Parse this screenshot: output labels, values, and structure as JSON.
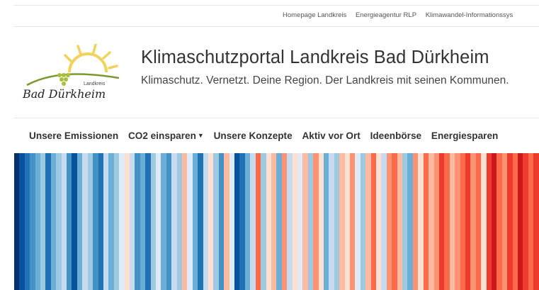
{
  "top_links": [
    "Homepage Landkreis",
    "Energieagentur RLP",
    "Klimawandel-Informationssys"
  ],
  "logo": {
    "small_text": "Landkreis",
    "script_text": "Bad Dürkheim",
    "sun_color": "#f2d35a",
    "hills_color": "#7a9a2e",
    "grapes_color": "#a8be3c"
  },
  "header": {
    "title": "Klimaschutzportal Landkreis Bad Dürkheim",
    "tagline": "Klimaschutz. Vernetzt. Deine Region. Der Landkreis mit seinen Kommunen."
  },
  "nav": [
    {
      "label": "Unsere Emissionen",
      "dropdown": false
    },
    {
      "label": "CO2 einsparen",
      "dropdown": true
    },
    {
      "label": "Unsere Konzepte",
      "dropdown": false
    },
    {
      "label": "Aktiv vor Ort",
      "dropdown": false
    },
    {
      "label": "Ideenbörse",
      "dropdown": false
    },
    {
      "label": "Energiesparen",
      "dropdown": false
    }
  ],
  "warming_stripes": [
    "#08306b",
    "#08519c",
    "#2171b5",
    "#4292c6",
    "#6baed6",
    "#9ecae1",
    "#2171b5",
    "#6baed6",
    "#9ecae1",
    "#c6dbef",
    "#4292c6",
    "#08519c",
    "#6baed6",
    "#c6dbef",
    "#9ecae1",
    "#4292c6",
    "#2171b5",
    "#c6dbef",
    "#6baed6",
    "#9ecae1",
    "#deebf7",
    "#fee0d2",
    "#c6dbef",
    "#4292c6",
    "#6baed6",
    "#2171b5",
    "#9ecae1",
    "#deebf7",
    "#6baed6",
    "#4292c6",
    "#c6dbef",
    "#9ecae1",
    "#fcbba1",
    "#deebf7",
    "#6baed6",
    "#2171b5",
    "#c6dbef",
    "#fee0d2",
    "#9ecae1",
    "#4292c6",
    "#fcbba1",
    "#deebf7",
    "#08519c",
    "#2171b5",
    "#6baed6",
    "#c6dbef",
    "#fb6a4a",
    "#9ecae1",
    "#fee0d2",
    "#fcbba1",
    "#6baed6",
    "#fc9272",
    "#c6dbef",
    "#fee0d2",
    "#deebf7",
    "#fcbba1",
    "#9ecae1",
    "#fc9272",
    "#fee0d2",
    "#6baed6",
    "#c6dbef",
    "#9ecae1",
    "#fcbba1",
    "#fee0d2",
    "#fc9272",
    "#deebf7",
    "#9ecae1",
    "#fcbba1",
    "#fb6a4a",
    "#fee0d2",
    "#c6dbef",
    "#fc9272",
    "#fb6a4a",
    "#fcbba1",
    "#9ecae1",
    "#6baed6",
    "#fc9272",
    "#fee0d2",
    "#fb6a4a",
    "#fcbba1",
    "#fc9272",
    "#ef3b2c",
    "#fb6a4a",
    "#fcbba1",
    "#fc9272",
    "#fb6a4a",
    "#ef3b2c",
    "#fc9272",
    "#fb6a4a",
    "#fee0d2",
    "#ef3b2c",
    "#cb181d",
    "#fb6a4a",
    "#fc9272",
    "#ef3b2c",
    "#fb6a4a",
    "#cb181d",
    "#ef3b2c",
    "#fb6a4a",
    "#ef3b2c"
  ]
}
